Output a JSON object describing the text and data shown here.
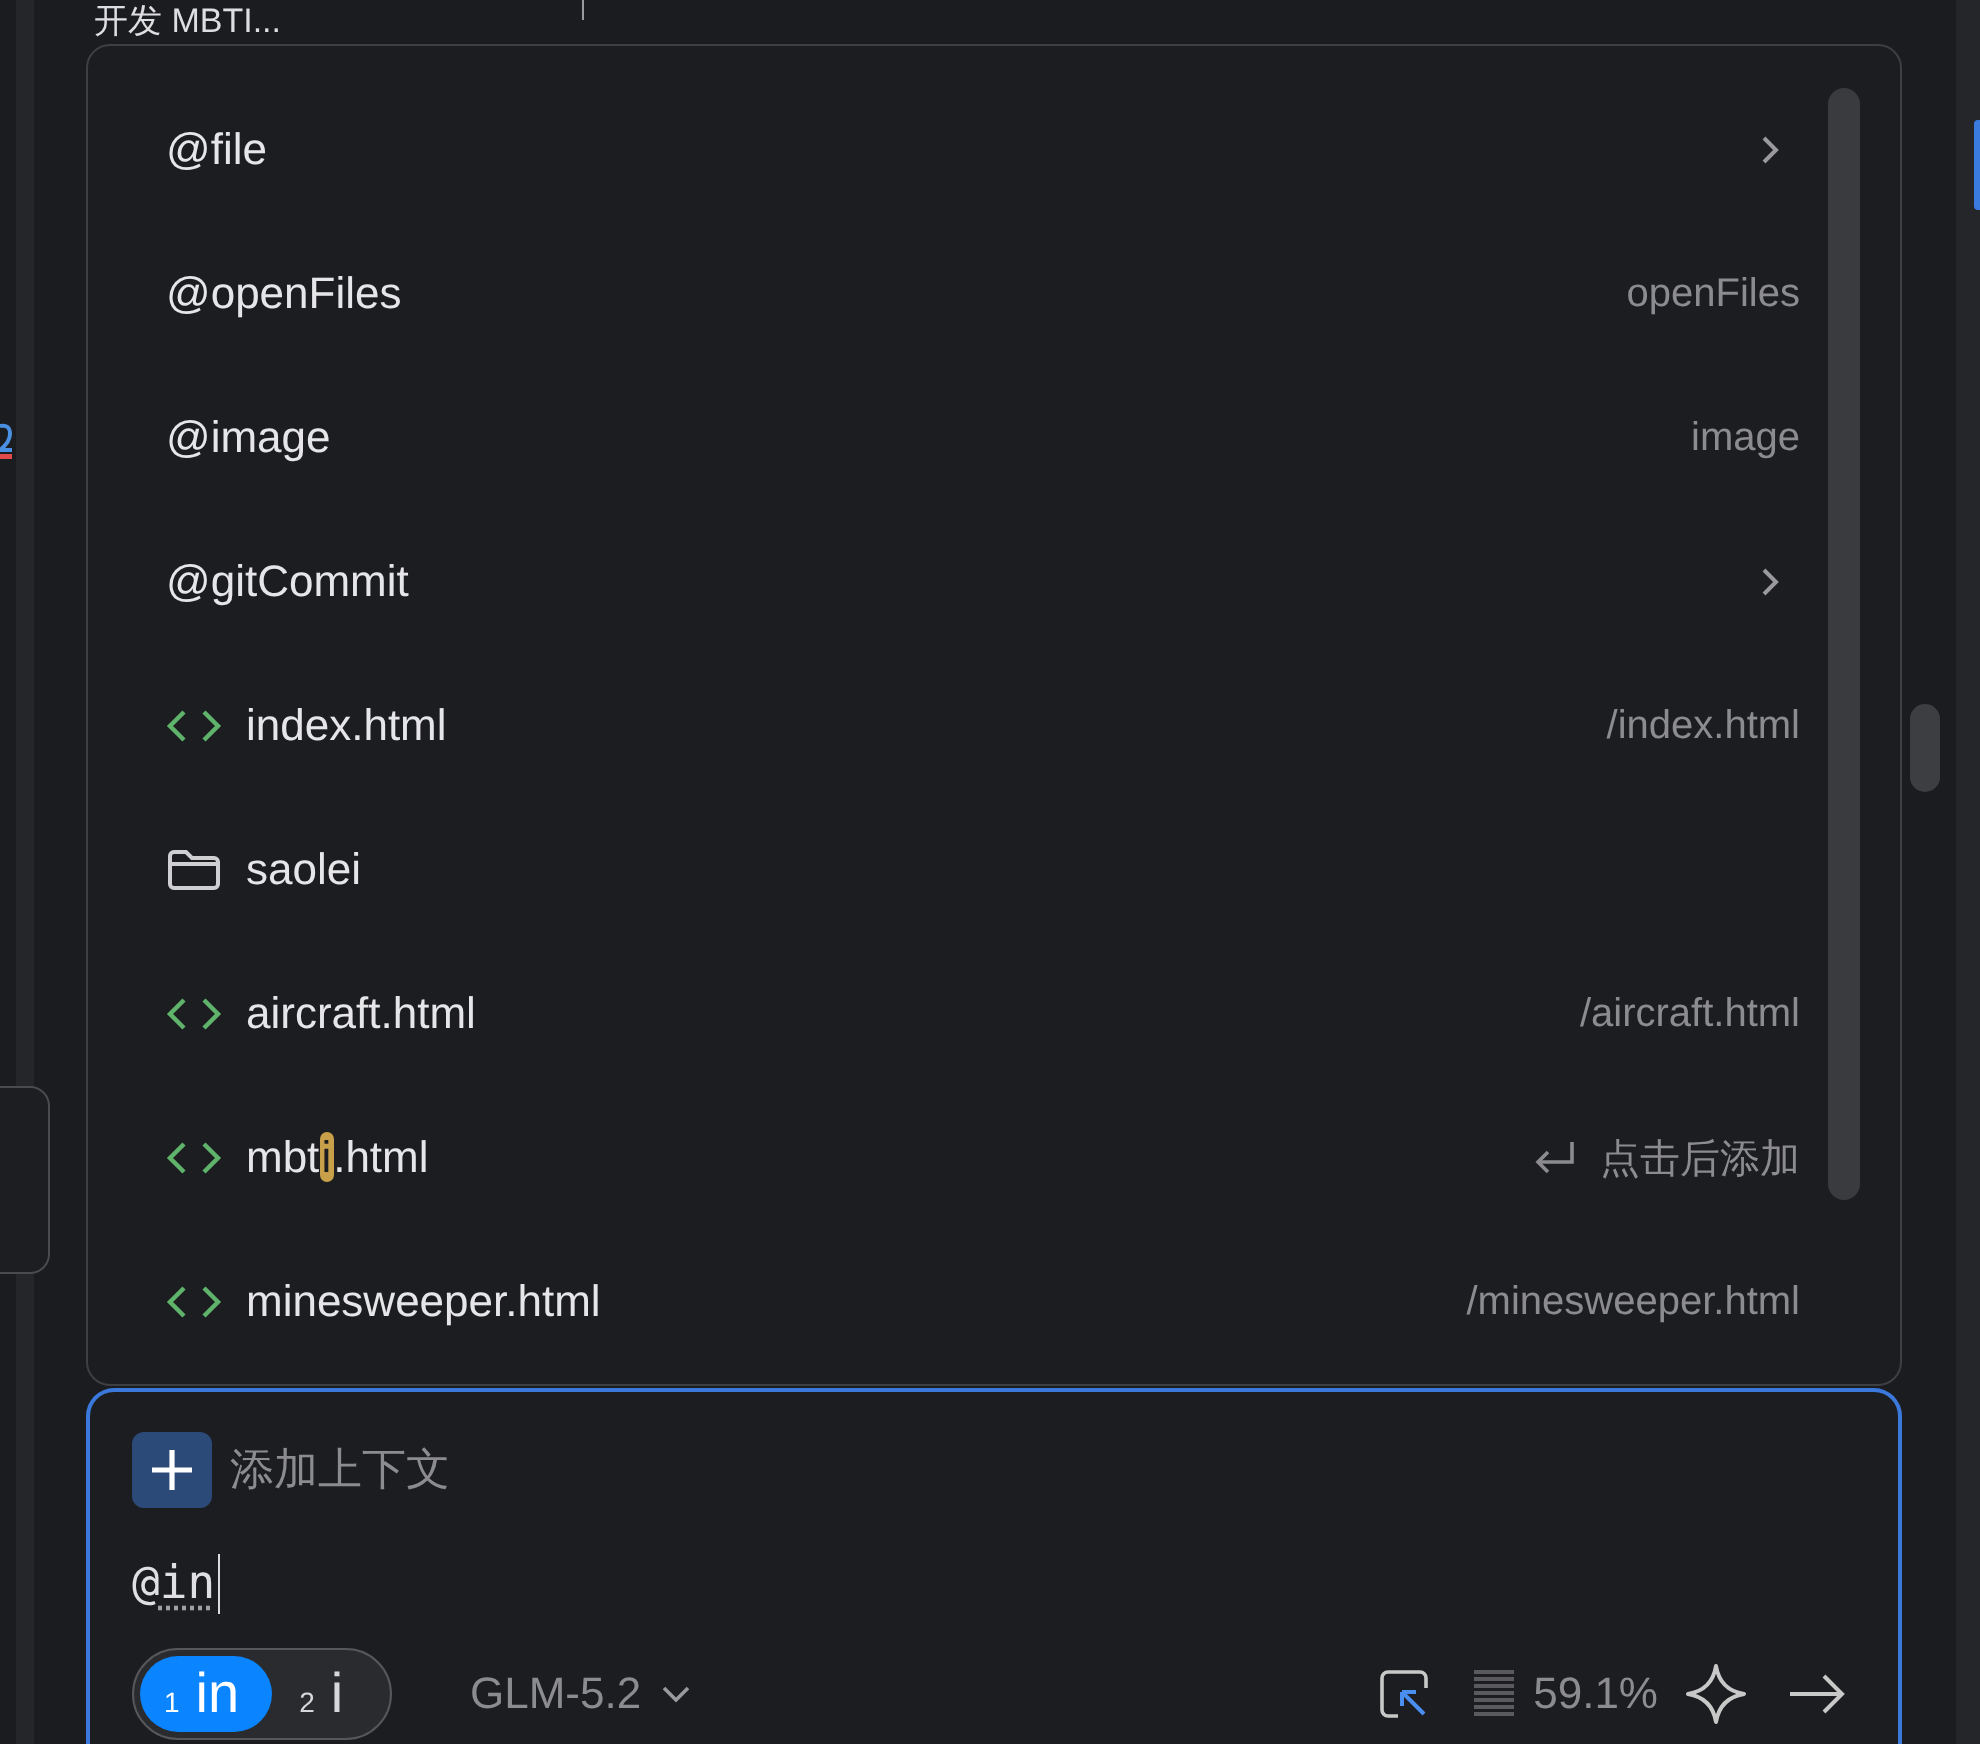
{
  "header": {
    "title": "开发 MBTI..."
  },
  "mentions": {
    "items": [
      {
        "kind": "mention",
        "label": "@file",
        "submenu": true
      },
      {
        "kind": "mention",
        "label": "@openFiles",
        "detail": "openFiles"
      },
      {
        "kind": "mention",
        "label": "@image",
        "detail": "image"
      },
      {
        "kind": "mention",
        "label": "@gitCommit",
        "submenu": true
      },
      {
        "kind": "file",
        "label": "index.html",
        "detail": "/index.html"
      },
      {
        "kind": "folder",
        "label": "saolei"
      },
      {
        "kind": "file",
        "label": "aircraft.html",
        "detail": "/aircraft.html"
      },
      {
        "kind": "file",
        "label_parts": [
          {
            "text": "mbt",
            "highlighted": false
          },
          {
            "text": "i",
            "highlighted": true
          },
          {
            "text": ".html",
            "highlighted": false
          }
        ],
        "detail": "点击后添加",
        "enter_hint": true
      },
      {
        "kind": "file",
        "label": "minesweeper.html",
        "detail": "/minesweeper.html"
      }
    ]
  },
  "composer": {
    "add_context": "添加上下文",
    "input": {
      "value": "@",
      "composition": "in"
    },
    "candidates": [
      {
        "number": "1",
        "text": "in",
        "selected": true
      },
      {
        "number": "2",
        "text": "i",
        "selected": false
      }
    ],
    "model": "GLM-5.2",
    "context_usage": "59.1%"
  }
}
